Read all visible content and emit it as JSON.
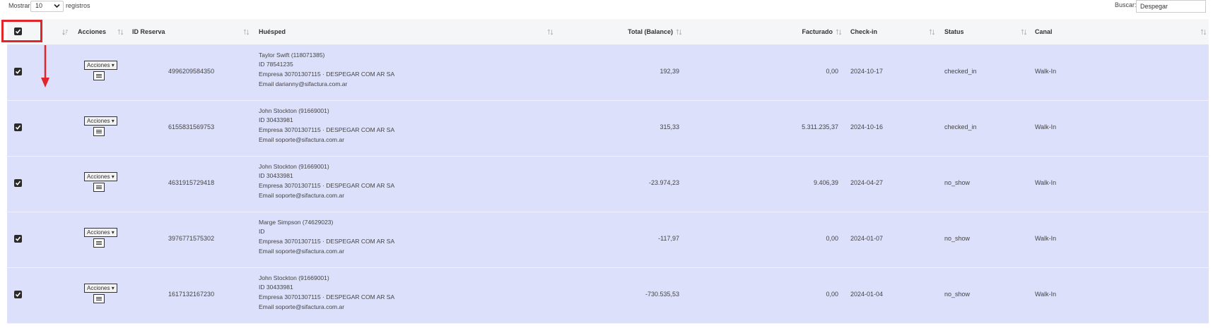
{
  "toolbar": {
    "show_label": "Mostrar",
    "page_length": "10",
    "records_label": "registros",
    "search_label": "Buscar:",
    "search_value": "Despegar"
  },
  "columns": {
    "actions": "Acciones",
    "reservation_id": "ID Reserva",
    "guest": "Huésped",
    "total": "Total (Balance)",
    "invoiced": "Facturado",
    "checkin": "Check-in",
    "status": "Status",
    "channel": "Canal"
  },
  "row_button_label": "Acciones",
  "rows": [
    {
      "id": "4996209584350",
      "guest_name": "Taylor Swift (118071385)",
      "guest_id": "ID 78541235",
      "company": "Empresa 30701307115 · DESPEGAR COM AR SA",
      "email": "Email darianny@sifactura.com.ar",
      "total": "192,39",
      "invoiced": "0,00",
      "checkin": "2024-10-17",
      "status": "checked_in",
      "channel": "Walk-In"
    },
    {
      "id": "6155831569753",
      "guest_name": "John Stockton (91669001)",
      "guest_id": "ID 30433981",
      "company": "Empresa 30701307115 · DESPEGAR COM AR SA",
      "email": "Email soporte@sifactura.com.ar",
      "total": "315,33",
      "invoiced": "5.311.235,37",
      "checkin": "2024-10-16",
      "status": "checked_in",
      "channel": "Walk-In"
    },
    {
      "id": "4631915729418",
      "guest_name": "John Stockton (91669001)",
      "guest_id": "ID 30433981",
      "company": "Empresa 30701307115 · DESPEGAR COM AR SA",
      "email": "Email soporte@sifactura.com.ar",
      "total": "-23.974,23",
      "invoiced": "9.406,39",
      "checkin": "2024-04-27",
      "status": "no_show",
      "channel": "Walk-In"
    },
    {
      "id": "3976771575302",
      "guest_name": "Marge Simpson (74629023)",
      "guest_id": "ID",
      "company": "Empresa 30701307115 · DESPEGAR COM AR SA",
      "email": "Email soporte@sifactura.com.ar",
      "total": "-117,97",
      "invoiced": "0,00",
      "checkin": "2024-01-07",
      "status": "no_show",
      "channel": "Walk-In"
    },
    {
      "id": "1617132167230",
      "guest_name": "John Stockton (91669001)",
      "guest_id": "ID 30433981",
      "company": "Empresa 30701307115 · DESPEGAR COM AR SA",
      "email": "Email soporte@sifactura.com.ar",
      "total": "-730.535,53",
      "invoiced": "0,00",
      "checkin": "2024-01-04",
      "status": "no_show",
      "channel": "Walk-In"
    }
  ],
  "colors": {
    "row_selected": "#dde0fb",
    "header_bg": "#f5f6f8",
    "annotation_red": "#e0262b"
  }
}
